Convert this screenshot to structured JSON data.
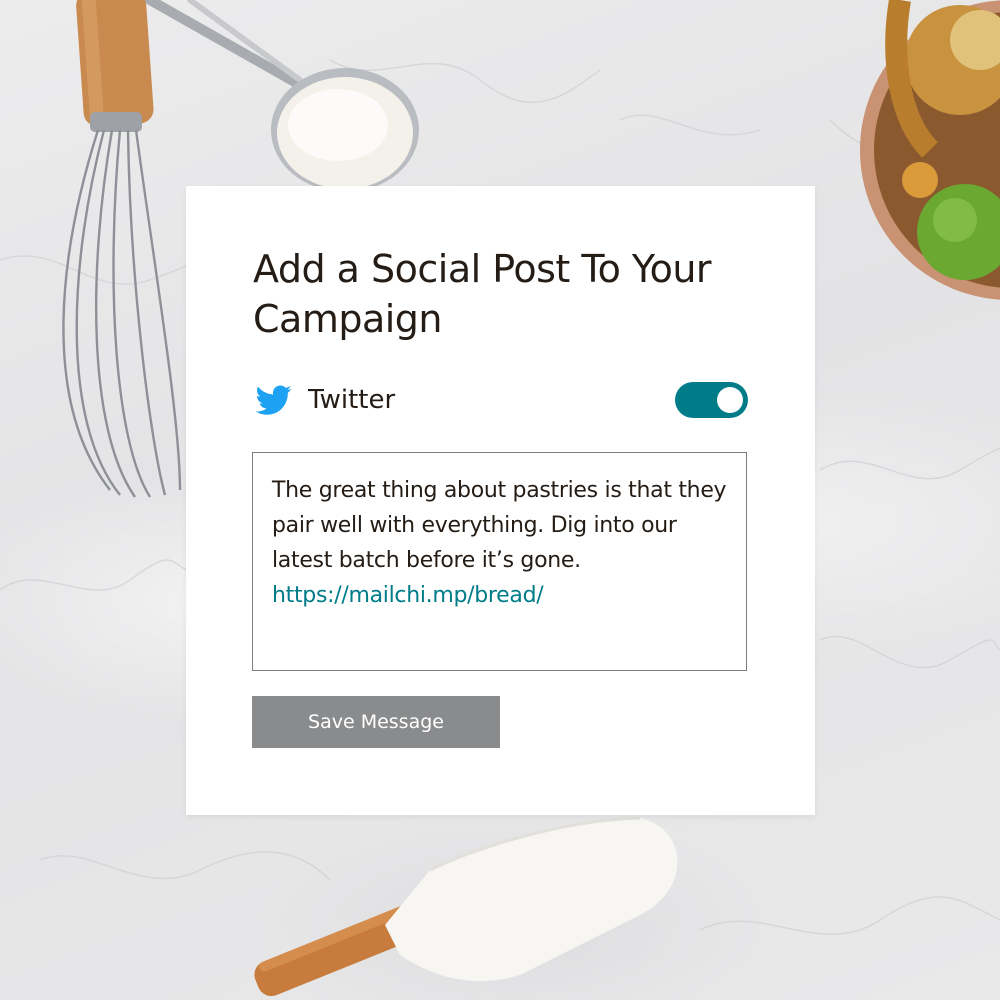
{
  "card": {
    "title": "Add a Social Post To Your Campaign"
  },
  "network": {
    "name": "Twitter",
    "icon": "twitter-bird-icon",
    "enabled": true,
    "icon_color": "#1da1f2",
    "toggle_color": "#007c89"
  },
  "message": {
    "body": "The great thing about pastries is that they pair well with everything. Dig into our latest batch before it’s gone.",
    "link": "https://mailchi.mp/bread/",
    "link_color": "#007c89"
  },
  "actions": {
    "save_label": "Save Message",
    "save_color": "#8a8b8d"
  }
}
